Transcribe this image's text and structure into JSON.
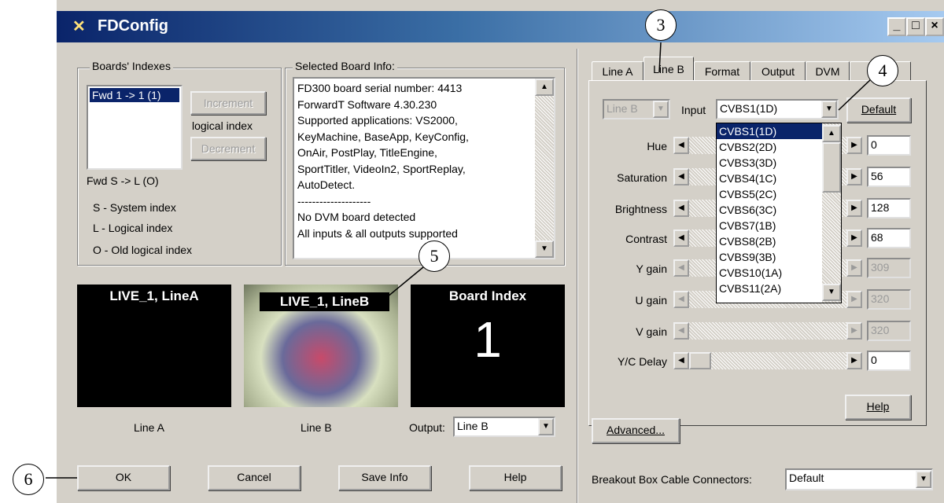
{
  "window": {
    "title": "FDConfig",
    "title_icon": "tools-icon",
    "buttons": [
      "minimize",
      "maximize",
      "close"
    ]
  },
  "boards_indexes": {
    "label": "Boards' Indexes",
    "list_items": [
      "Fwd 1 -> 1 (1)"
    ],
    "increment_label": "Increment",
    "logical_index_label": "logical index",
    "decrement_label": "Decrement",
    "legend": [
      "Fwd S -> L (O)",
      "S - System index",
      "L - Logical index",
      "O - Old logical index"
    ]
  },
  "board_info": {
    "label": "Selected Board Info:",
    "lines": [
      "FD300 board serial number: 4413",
      "ForwardT Software 4.30.230",
      "Supported applications: VS2000,",
      "KeyMachine, BaseApp, KeyConfig,",
      "OnAir, PostPlay, TitleEngine,",
      "SportTitler, VideoIn2, SportReplay,",
      "AutoDetect.",
      "--------------------",
      "No DVM board detected",
      "All inputs & all outputs supported"
    ]
  },
  "previews": {
    "line_a": {
      "overlay": "LIVE_1, LineA",
      "caption": "Line A"
    },
    "line_b": {
      "overlay": "LIVE_1, LineB",
      "caption": "Line B"
    },
    "board_index": {
      "title": "Board Index",
      "value": "1"
    },
    "output_label": "Output:",
    "output_value": "Line B"
  },
  "bottom_buttons": {
    "ok": "OK",
    "cancel": "Cancel",
    "save_info": "Save Info",
    "help": "Help"
  },
  "tabs": [
    "Line A",
    "Line B",
    "Format",
    "Output",
    "DVM"
  ],
  "line_b_tab": {
    "line_select": "Line B",
    "input_label": "Input",
    "input_value": "CVBS1(1D)",
    "default_label": "Default",
    "dropdown_options": [
      "CVBS1(1D)",
      "CVBS2(2D)",
      "CVBS3(3D)",
      "CVBS4(1C)",
      "CVBS5(2C)",
      "CVBS6(3C)",
      "CVBS7(1B)",
      "CVBS8(2B)",
      "CVBS9(3B)",
      "CVBS10(1A)",
      "CVBS11(2A)"
    ],
    "sliders": [
      {
        "label": "Hue",
        "value": "0",
        "enabled": true
      },
      {
        "label": "Saturation",
        "value": "56",
        "enabled": true
      },
      {
        "label": "Brightness",
        "value": "128",
        "enabled": true
      },
      {
        "label": "Contrast",
        "value": "68",
        "enabled": true
      },
      {
        "label": "Y gain",
        "value": "309",
        "enabled": false
      },
      {
        "label": "U gain",
        "value": "320",
        "enabled": false
      },
      {
        "label": "V gain",
        "value": "320",
        "enabled": false
      },
      {
        "label": "Y/C Delay",
        "value": "0",
        "enabled": true
      }
    ],
    "help_label": "Help"
  },
  "advanced_label": "Advanced...",
  "breakout": {
    "label": "Breakout Box Cable Connectors:",
    "value": "Default"
  },
  "callouts": [
    "3",
    "4",
    "5",
    "6"
  ],
  "colors": {
    "title_start": "#0a246a",
    "title_end": "#a6caf0",
    "face": "#d4d0c8",
    "selection": "#0a246a"
  }
}
